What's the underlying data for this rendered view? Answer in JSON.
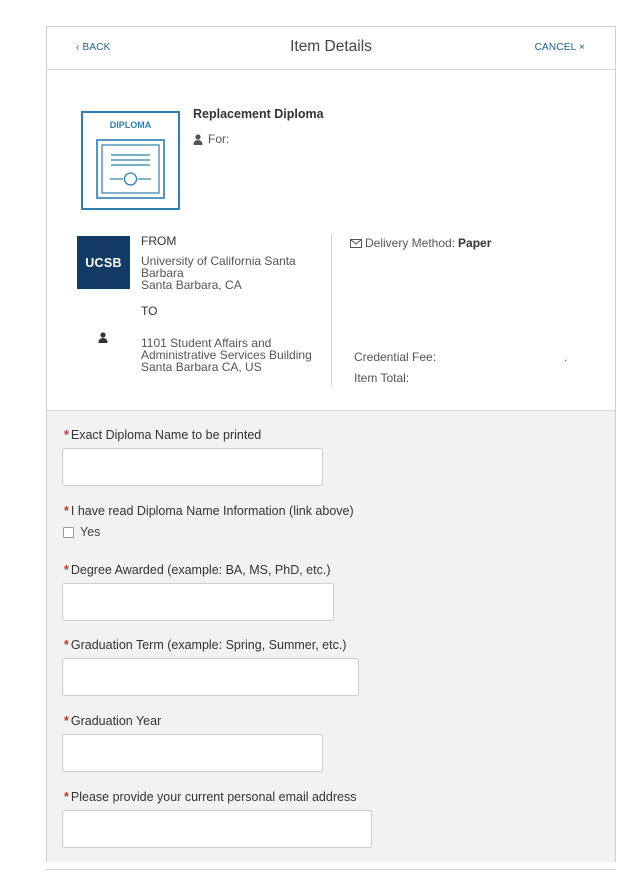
{
  "header": {
    "back_label": "‹ BACK",
    "title": "Item Details",
    "cancel_label": "CANCEL ×"
  },
  "item": {
    "image_label": "DIPLOMA",
    "name": "Replacement Diploma",
    "for_label": "For:"
  },
  "shipment": {
    "logo_text": "UCSB",
    "from_label": "FROM",
    "from_line1": "University of California Santa",
    "from_line2": "Barbara",
    "from_line3": "Santa Barbara, CA",
    "to_label": "TO",
    "to_line1": "1101 Student Affairs and",
    "to_line2": "Administrative Services Building",
    "to_line3": "Santa Barbara CA, US"
  },
  "delivery": {
    "label": "Delivery Method:",
    "value": "Paper"
  },
  "pricing": {
    "fee_label": "Credential Fee:",
    "fee_value": ".",
    "total_label": "Item Total:"
  },
  "form": {
    "required_mark": "*",
    "diploma_name_label": "Exact Diploma Name to be printed",
    "diploma_name_value": "",
    "read_info_label": "I have read Diploma Name Information (link above)",
    "read_info_option": "Yes",
    "degree_label": "Degree Awarded (example: BA, MS, PhD, etc.)",
    "degree_value": "",
    "term_label": "Graduation Term (example: Spring, Summer, etc.)",
    "term_value": "",
    "year_label": "Graduation Year",
    "year_value": "",
    "email_label": "Please provide your current personal email address",
    "email_value": ""
  },
  "colors": {
    "link": "#1f5f8b",
    "logo_bg": "#123a63",
    "diploma_border": "#2e7fae",
    "required": "#c0392b",
    "form_bg": "#f2f2f2"
  },
  "icons": {
    "person": "person-icon",
    "envelope": "envelope-icon",
    "diploma": "diploma-certificate-icon"
  }
}
